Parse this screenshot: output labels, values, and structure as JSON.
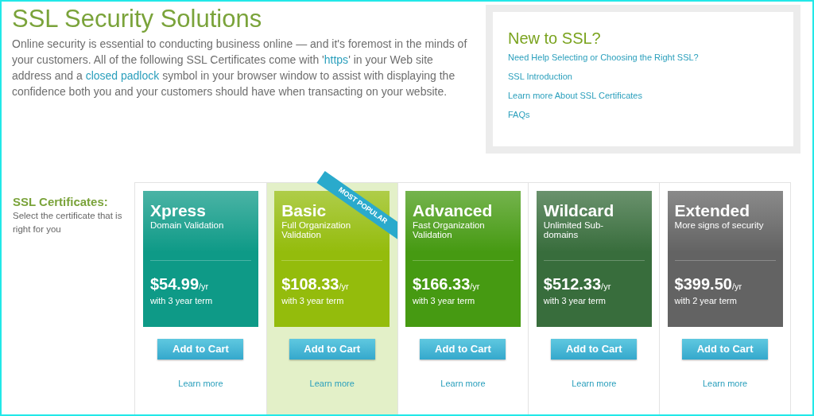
{
  "header": {
    "title": "SSL Security Solutions",
    "intro": "Online security is essential to conducting business online — and it's foremost in the minds of your customers. All of the following SSL Certificates come with '",
    "intro_link_1": "https",
    "intro_mid": "' in your Web site address and a ",
    "intro_link_2": "closed padlock",
    "intro_end": " symbol in your browser window to assist with displaying the confidence both you and your customers should have when transacting on your website."
  },
  "help_box": {
    "title": "New to SSL?",
    "links": [
      "Need Help Selecting or Choosing the Right SSL?",
      "SSL Introduction",
      "Learn more About SSL Certificates",
      "FAQs"
    ]
  },
  "certificates": {
    "title": "SSL Certificates:",
    "subtitle": "Select the certificate that is right for you",
    "plans": [
      {
        "name": "Xpress",
        "description": "Domain Validation",
        "price": "$54.99",
        "unit": "/yr",
        "term": "with 3 year term",
        "button": "Add to Cart",
        "link": "Learn more",
        "color": "#0e9a87",
        "featured": false
      },
      {
        "name": "Basic",
        "description": "Full Organization Validation",
        "price": "$108.33",
        "unit": "/yr",
        "term": "with 3 year term",
        "button": "Add to Cart",
        "link": "Learn more",
        "color": "#94bc0c",
        "featured": true,
        "ribbon": "MOST POPULAR"
      },
      {
        "name": "Advanced",
        "description": "Fast Organization Validation",
        "price": "$166.33",
        "unit": "/yr",
        "term": "with 3 year term",
        "button": "Add to Cart",
        "link": "Learn more",
        "color": "#469a12",
        "featured": false
      },
      {
        "name": "Wildcard",
        "description": "Unlimited Sub-domains",
        "price": "$512.33",
        "unit": "/yr",
        "term": "with 3 year term",
        "button": "Add to Cart",
        "link": "Learn more",
        "color": "#386d3c",
        "featured": false
      },
      {
        "name": "Extended",
        "description": "More signs of security",
        "price": "$399.50",
        "unit": "/yr",
        "term": "with 2 year term",
        "button": "Add to Cart",
        "link": "Learn more",
        "color": "#636363",
        "featured": false
      }
    ]
  }
}
